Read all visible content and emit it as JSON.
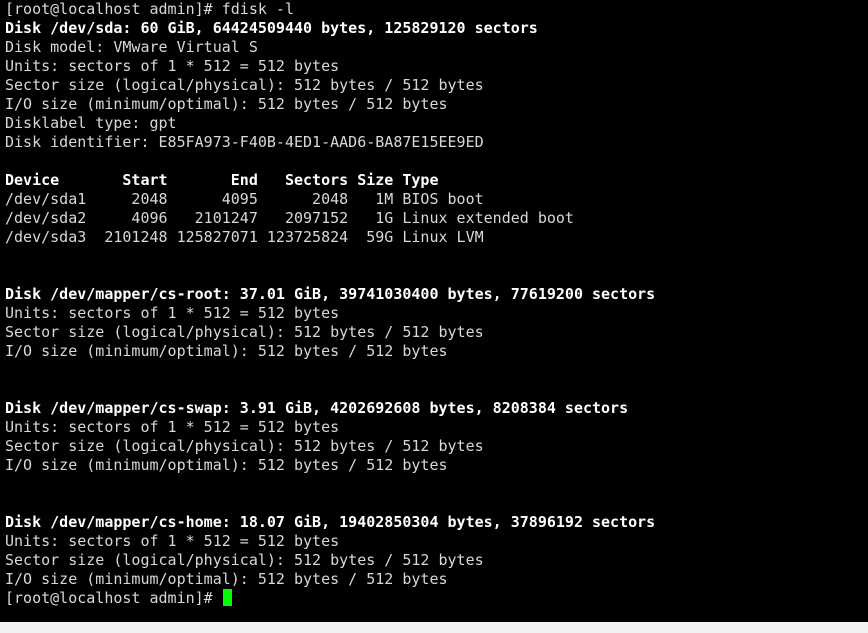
{
  "terminal": {
    "lines": [
      {
        "text": "[root@localhost admin]# fdisk -l",
        "bold": false
      },
      {
        "text": "Disk /dev/sda: 60 GiB, 64424509440 bytes, 125829120 sectors",
        "bold": true
      },
      {
        "text": "Disk model: VMware Virtual S",
        "bold": false
      },
      {
        "text": "Units: sectors of 1 * 512 = 512 bytes",
        "bold": false
      },
      {
        "text": "Sector size (logical/physical): 512 bytes / 512 bytes",
        "bold": false
      },
      {
        "text": "I/O size (minimum/optimal): 512 bytes / 512 bytes",
        "bold": false
      },
      {
        "text": "Disklabel type: gpt",
        "bold": false
      },
      {
        "text": "Disk identifier: E85FA973-F40B-4ED1-AAD6-BA87E15EE9ED",
        "bold": false
      },
      {
        "text": "",
        "bold": false
      },
      {
        "text": "Device       Start       End   Sectors Size Type",
        "bold": true
      },
      {
        "text": "/dev/sda1     2048      4095      2048   1M BIOS boot",
        "bold": false
      },
      {
        "text": "/dev/sda2     4096   2101247   2097152   1G Linux extended boot",
        "bold": false
      },
      {
        "text": "/dev/sda3  2101248 125827071 123725824  59G Linux LVM",
        "bold": false
      },
      {
        "text": "",
        "bold": false
      },
      {
        "text": "",
        "bold": false
      },
      {
        "text": "Disk /dev/mapper/cs-root: 37.01 GiB, 39741030400 bytes, 77619200 sectors",
        "bold": true
      },
      {
        "text": "Units: sectors of 1 * 512 = 512 bytes",
        "bold": false
      },
      {
        "text": "Sector size (logical/physical): 512 bytes / 512 bytes",
        "bold": false
      },
      {
        "text": "I/O size (minimum/optimal): 512 bytes / 512 bytes",
        "bold": false
      },
      {
        "text": "",
        "bold": false
      },
      {
        "text": "",
        "bold": false
      },
      {
        "text": "Disk /dev/mapper/cs-swap: 3.91 GiB, 4202692608 bytes, 8208384 sectors",
        "bold": true
      },
      {
        "text": "Units: sectors of 1 * 512 = 512 bytes",
        "bold": false
      },
      {
        "text": "Sector size (logical/physical): 512 bytes / 512 bytes",
        "bold": false
      },
      {
        "text": "I/O size (minimum/optimal): 512 bytes / 512 bytes",
        "bold": false
      },
      {
        "text": "",
        "bold": false
      },
      {
        "text": "",
        "bold": false
      },
      {
        "text": "Disk /dev/mapper/cs-home: 18.07 GiB, 19402850304 bytes, 37896192 sectors",
        "bold": true
      },
      {
        "text": "Units: sectors of 1 * 512 = 512 bytes",
        "bold": false
      },
      {
        "text": "Sector size (logical/physical): 512 bytes / 512 bytes",
        "bold": false
      },
      {
        "text": "I/O size (minimum/optimal): 512 bytes / 512 bytes",
        "bold": false
      }
    ],
    "prompt": "[root@localhost admin]# ",
    "cursor_color": "#00ff00",
    "background_color": "#000000",
    "text_color": "#d8d8d8"
  }
}
